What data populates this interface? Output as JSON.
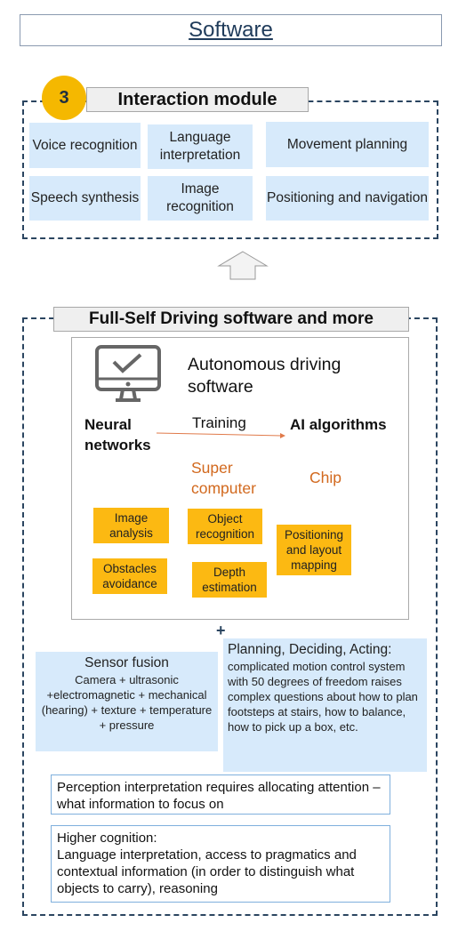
{
  "header": {
    "title": "Software"
  },
  "interaction": {
    "number": "3",
    "title": "Interaction module",
    "cells": [
      "Voice recognition",
      "Language interpretation",
      "Movement planning",
      "Speech synthesis",
      "Image recognition",
      "Positioning and navigation"
    ]
  },
  "fsd": {
    "title": "Full-Self Driving software and more",
    "heading": "Autonomous driving software",
    "neural": "Neural networks",
    "training": "Training",
    "ai": "AI algorithms",
    "super": "Super computer",
    "chip": "Chip",
    "tasks": [
      "Image analysis",
      "Object recognition",
      "Positioning and layout mapping",
      "Obstacles avoidance",
      "Depth estimation"
    ],
    "plus": "+",
    "sensor_title": "Sensor fusion",
    "sensor_body": "Camera + ultrasonic +electromagnetic + mechanical (hearing) + texture + temperature + pressure",
    "planning_title": "Planning, Deciding, Acting:",
    "planning_body": "complicated motion control system with 50 degrees of freedom raises complex questions about how to plan footsteps at stairs, how to balance, how to pick up a box, etc.",
    "perception": "Perception interpretation requires allocating attention – what information to focus on",
    "cognition_title": "Higher cognition:",
    "cognition_body": "Language interpretation, access to pragmatics and contextual information (in order to distinguish what objects to carry), reasoning"
  },
  "colors": {
    "accent": "#f5b800",
    "blue": "#d7eafb",
    "orange_text": "#d2691e",
    "dash": "#2b4560"
  }
}
